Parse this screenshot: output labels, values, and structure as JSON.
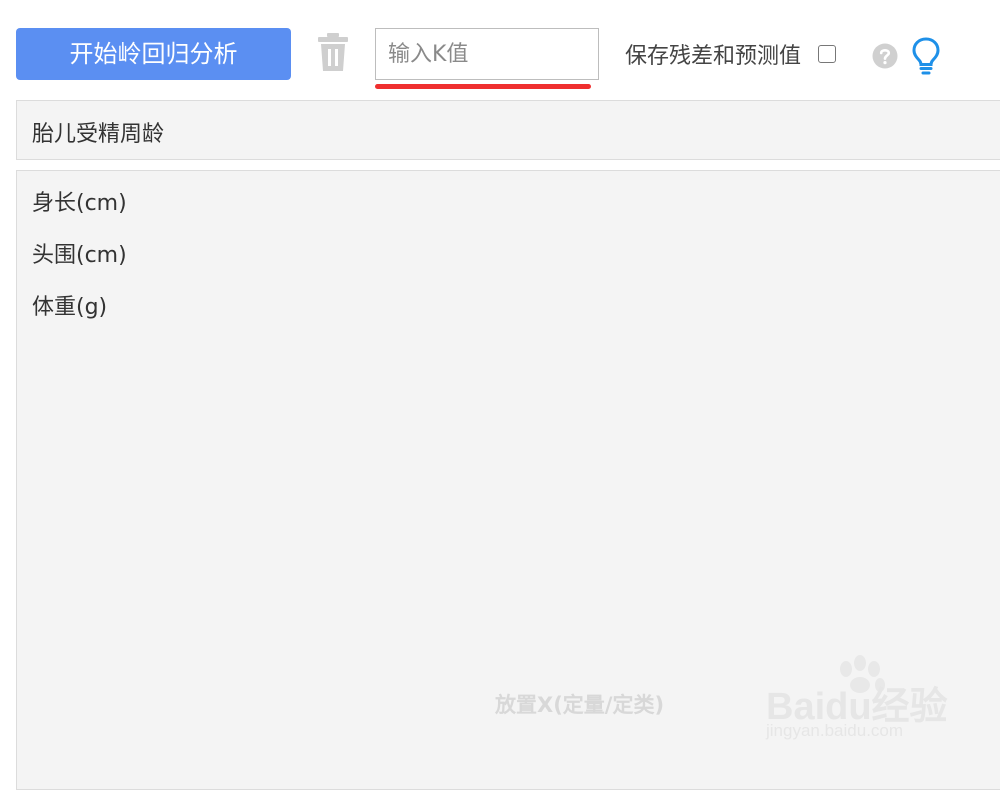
{
  "toolbar": {
    "start_label": "开始岭回归分析",
    "k_placeholder": "输入K值",
    "save_label": "保存残差和预测值",
    "save_checked": false,
    "trash_icon": "trash-icon",
    "help_icon": "help-circle-icon",
    "bulb_icon": "lightbulb-icon",
    "accent_color": "#5b8ff2",
    "underline_color": "#ef2f2f"
  },
  "y_box": {
    "items": [
      "胎儿受精周龄"
    ]
  },
  "x_box": {
    "items": [
      "身长(cm)",
      "头围(cm)",
      "体重(g)"
    ],
    "hint": "放置X(定量/定类)"
  },
  "watermark": {
    "brand": "Baidu经验",
    "url": "jingyan.baidu.com"
  }
}
